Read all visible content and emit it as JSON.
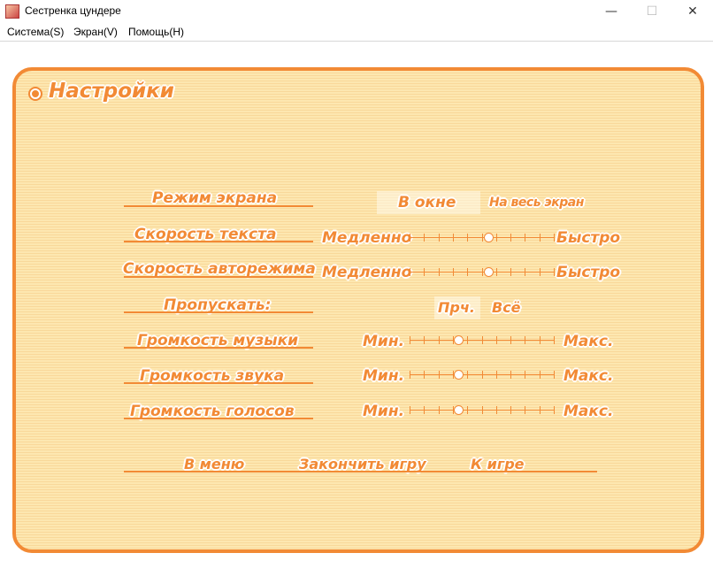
{
  "window": {
    "title": "Сестренка цундере",
    "minimize": "—",
    "maximize": "☐",
    "close": "✕"
  },
  "menu": {
    "items": [
      "Система(S)",
      "Экран(V)",
      "Помощь(H)"
    ]
  },
  "settings": {
    "title": "Настройки",
    "screen_mode": {
      "label": "Режим экрана",
      "options": [
        "В окне",
        "На весь экран"
      ],
      "selected": "В окне"
    },
    "text_speed": {
      "label": "Скорость текста",
      "min": "Медленно",
      "max": "Быстро",
      "value": 0.55
    },
    "auto_speed": {
      "label": "Скорость авторежима",
      "min": "Медленно",
      "max": "Быстро",
      "value": 0.55
    },
    "skip": {
      "label": "Пропускать:",
      "options": [
        "Прч.",
        "Всё"
      ],
      "selected": "Прч."
    },
    "music_volume": {
      "label": "Громкость музыки",
      "min": "Мин.",
      "max": "Макс.",
      "value": 0.33
    },
    "sound_volume": {
      "label": "Громкость звука",
      "min": "Мин.",
      "max": "Макс.",
      "value": 0.33
    },
    "voice_volume": {
      "label": "Громкость голосов",
      "min": "Мин.",
      "max": "Макс.",
      "value": 0.33
    },
    "bottom": {
      "menu": "В меню",
      "quit": "Закончить игру",
      "back": "К игре"
    }
  },
  "colors": {
    "accent": "#f28a35",
    "panel": "#fde7b0"
  }
}
